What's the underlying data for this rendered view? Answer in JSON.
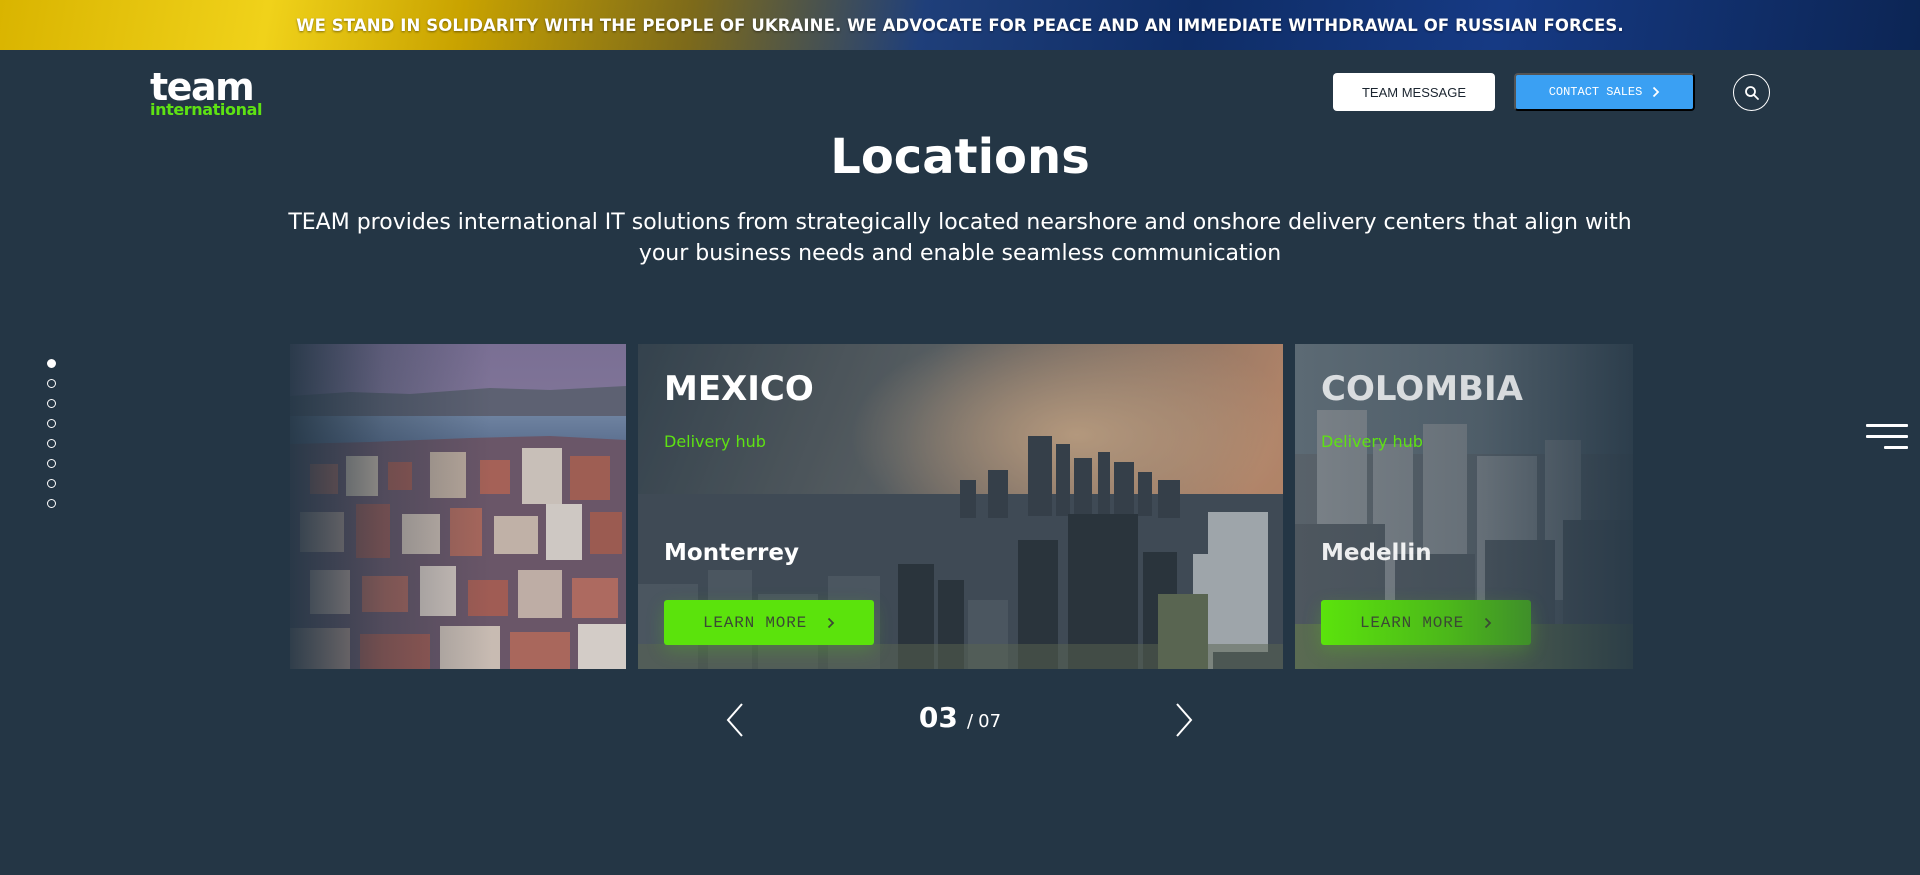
{
  "banner": {
    "text": "WE STAND IN SOLIDARITY WITH THE PEOPLE OF UKRAINE. WE ADVOCATE FOR PEACE AND AN IMMEDIATE WITHDRAWAL OF RUSSIAN FORCES."
  },
  "header": {
    "logo_line1": "team",
    "logo_line2": "international",
    "team_message_label": "TEAM MESSAGE",
    "contact_sales_label": "CONTACT SALES",
    "search_icon": "search-icon"
  },
  "main": {
    "title": "Locations",
    "subtitle": "TEAM provides international IT solutions from strategically located nearshore and onshore delivery centers that align with your business needs and enable seamless communication"
  },
  "side_nav": {
    "dot_count": 8,
    "active_index": 0
  },
  "slides": [
    {
      "country": "",
      "type": "",
      "city": "",
      "button": ""
    },
    {
      "country": "MEXICO",
      "type": "Delivery hub",
      "city": "Monterrey",
      "button": "LEARN MORE"
    },
    {
      "country": "COLOMBIA",
      "type": "Delivery hub",
      "city": "Medellin",
      "button": "LEARN MORE"
    }
  ],
  "pager": {
    "current": "03",
    "separator": "/",
    "total": "07"
  },
  "colors": {
    "background": "#243645",
    "accent_green": "#5ee213",
    "contact_blue": "#3aa0f3"
  }
}
